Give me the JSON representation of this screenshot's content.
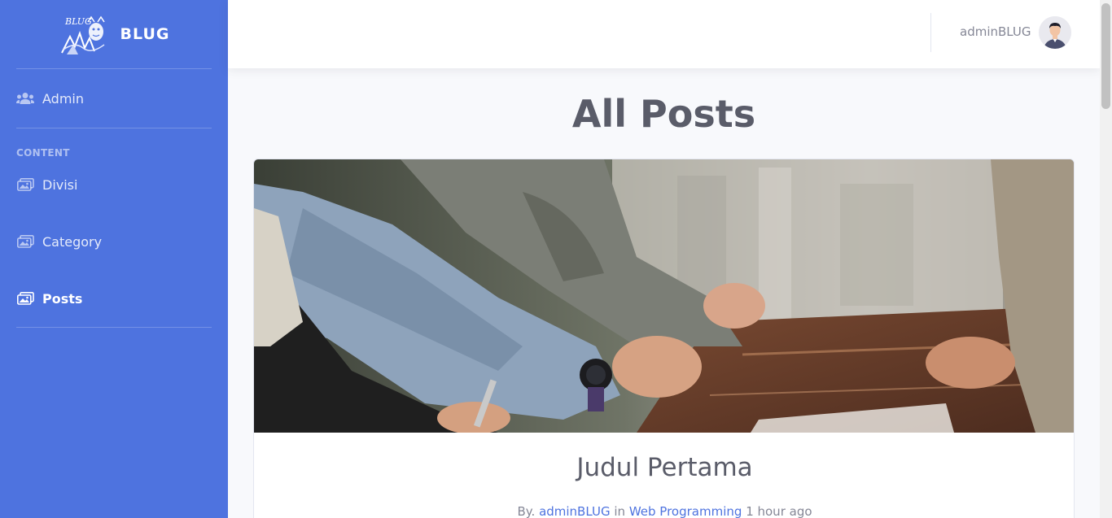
{
  "sidebar": {
    "brand": {
      "name": "BLUG",
      "logo_text": "BLUG"
    },
    "items": [
      {
        "label": "Admin",
        "icon": "users-icon"
      },
      {
        "label": "Divisi",
        "icon": "images-icon"
      },
      {
        "label": "Category",
        "icon": "images-icon"
      },
      {
        "label": "Posts",
        "icon": "images-icon",
        "active": true
      }
    ],
    "heading": "CONTENT"
  },
  "topbar": {
    "user_name": "adminBLUG",
    "avatar": "user-avatar"
  },
  "main": {
    "page_title": "All Posts",
    "post": {
      "image": "meeting-photo",
      "title": "Judul Pertama",
      "meta": {
        "prefix": "By.",
        "author": "adminBLUG",
        "connector": "in",
        "category": "Web Programming",
        "time": "1 hour ago"
      }
    }
  },
  "colors": {
    "sidebar_bg": "#4e73df",
    "link": "#4e73df",
    "title": "#5a5c69",
    "muted": "#858796"
  }
}
